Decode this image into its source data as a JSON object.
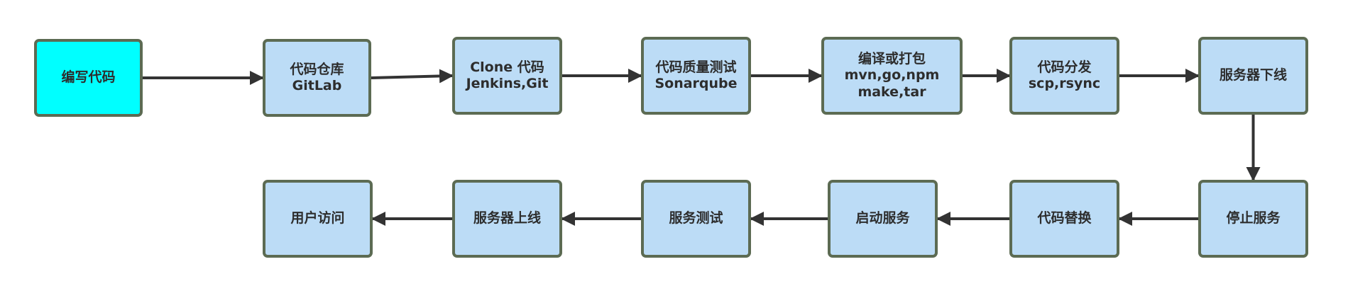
{
  "colors": {
    "start_fill": "#00ffff",
    "node_fill": "#bcdcf6",
    "node_border": "#5c6b53",
    "arrow": "#333333",
    "text": "#2d2d2d"
  },
  "nodes": [
    {
      "id": "write-code",
      "lines": [
        "编写代码"
      ]
    },
    {
      "id": "code-repo",
      "lines": [
        "代码仓库",
        "GitLab"
      ]
    },
    {
      "id": "clone-code",
      "lines": [
        "Clone 代码",
        "Jenkins,Git"
      ]
    },
    {
      "id": "quality-test",
      "lines": [
        "代码质量测试",
        "Sonarqube"
      ]
    },
    {
      "id": "compile-package",
      "lines": [
        "编译或打包",
        "mvn,go,npm",
        "make,tar"
      ]
    },
    {
      "id": "distribute-code",
      "lines": [
        "代码分发",
        "scp,rsync"
      ]
    },
    {
      "id": "server-offline",
      "lines": [
        "服务器下线"
      ]
    },
    {
      "id": "stop-service",
      "lines": [
        "停止服务"
      ]
    },
    {
      "id": "replace-code",
      "lines": [
        "代码替换"
      ]
    },
    {
      "id": "start-service",
      "lines": [
        "启动服务"
      ]
    },
    {
      "id": "service-test",
      "lines": [
        "服务测试"
      ]
    },
    {
      "id": "server-online",
      "lines": [
        "服务器上线"
      ]
    },
    {
      "id": "user-access",
      "lines": [
        "用户访问"
      ]
    }
  ],
  "edges": [
    {
      "from": "write-code",
      "to": "code-repo"
    },
    {
      "from": "code-repo",
      "to": "clone-code"
    },
    {
      "from": "clone-code",
      "to": "quality-test"
    },
    {
      "from": "quality-test",
      "to": "compile-package"
    },
    {
      "from": "compile-package",
      "to": "distribute-code"
    },
    {
      "from": "distribute-code",
      "to": "server-offline"
    },
    {
      "from": "server-offline",
      "to": "stop-service"
    },
    {
      "from": "stop-service",
      "to": "replace-code"
    },
    {
      "from": "replace-code",
      "to": "start-service"
    },
    {
      "from": "start-service",
      "to": "service-test"
    },
    {
      "from": "service-test",
      "to": "server-online"
    },
    {
      "from": "server-online",
      "to": "user-access"
    }
  ]
}
